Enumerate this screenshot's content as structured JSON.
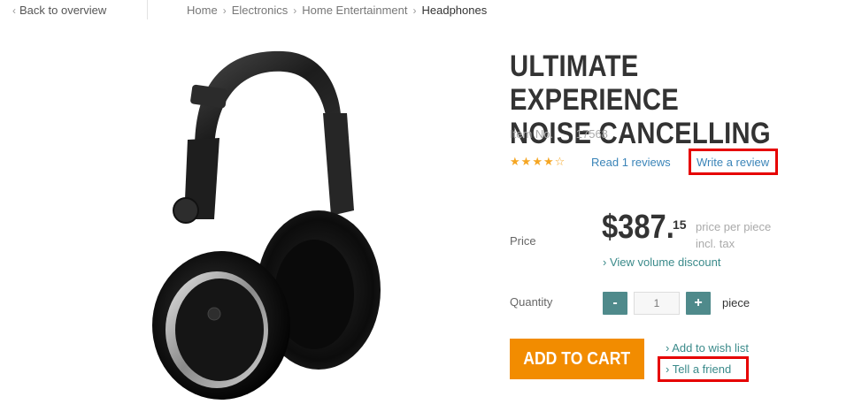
{
  "nav": {
    "back_chevron": "‹",
    "back_label": "Back to overview"
  },
  "breadcrumb": {
    "items": [
      "Home",
      "Electronics",
      "Home Entertainment",
      "Headphones"
    ],
    "separator": "›"
  },
  "product": {
    "title_line1": "ULTIMATE EXPERIENCE",
    "title_line2": "NOISE CANCELLING",
    "item_no_label": "Item No.",
    "item_no_value": "17568",
    "rating": 4,
    "rating_max": 5,
    "read_reviews_label": "Read 1 reviews",
    "write_review_label": "Write a review",
    "image_icon": "headphones-image"
  },
  "price": {
    "label": "Price",
    "main": "$387.",
    "cents": "15",
    "note_line1": "price per piece",
    "note_line2": "incl. tax",
    "volume_discount_label": "› View volume discount"
  },
  "quantity": {
    "label": "Quantity",
    "minus_label": "-",
    "plus_label": "+",
    "value": "1",
    "unit": "piece"
  },
  "actions": {
    "add_to_cart_label": "ADD TO CART",
    "wish_list_label": "› Add to wish list",
    "tell_friend_label": "› Tell a friend"
  },
  "colors": {
    "accent_orange": "#f28c00",
    "teal_button": "#4f8a8b",
    "link_blue": "#3a84b8",
    "highlight_red": "#e60000",
    "star": "#f5a623"
  }
}
